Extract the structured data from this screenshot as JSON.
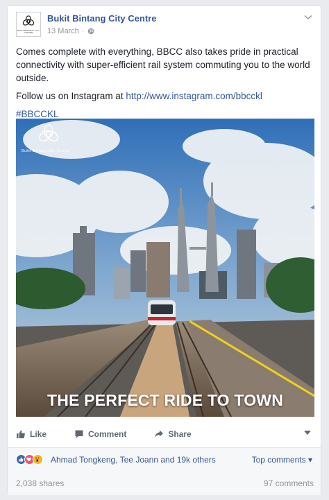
{
  "post": {
    "page_name": "Bukit Bintang City Centre",
    "date": "13 March",
    "separator": "·",
    "avatar_small_text": "BUKIT BINTANG CITY CENTRE",
    "paragraph1": "Comes complete with everything, BBCC also takes pride in practical connectivity with super-efficient rail system commuting you to the world outside.",
    "follow_text": "Follow us on Instagram at ",
    "follow_link": "http://www.instagram.com/bbcckl",
    "hashtag": "#BBCCKL",
    "photo_brand": "Bukit Bintang City Centre",
    "photo_caption": "THE PERFECT RIDE TO TOWN",
    "icons": [
      "bbcc-logo-icon",
      "globe-icon",
      "chevron-down-icon"
    ]
  },
  "actions": {
    "like": "Like",
    "comment": "Comment",
    "share": "Share",
    "icons": [
      "thumbs-up-icon",
      "comment-icon",
      "share-arrow-icon",
      "caret-down-icon"
    ]
  },
  "reactions": {
    "names": "Ahmad Tongkeng, Tee Joann and 19k others",
    "top_comments": "Top comments",
    "top_comments_arrow": "▾",
    "colors": {
      "like": "#4267b2",
      "love": "#f25268",
      "wow": "#f7b125"
    }
  },
  "footer": {
    "shares": "2,038 shares",
    "comments": "97 comments"
  }
}
